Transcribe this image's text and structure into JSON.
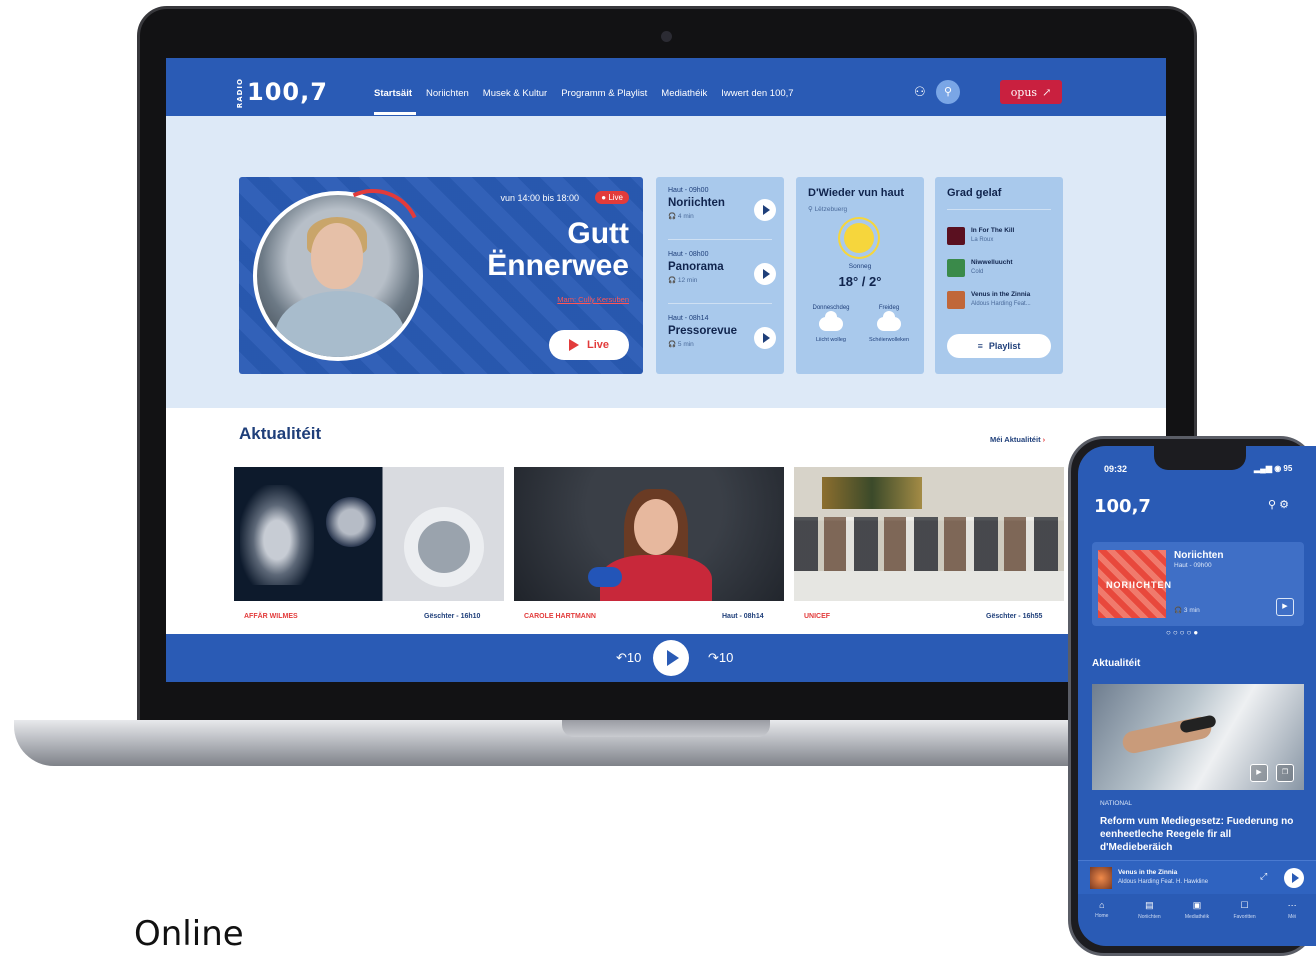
{
  "nav": {
    "logo": "100,7",
    "logo_small": "RADIO",
    "links": [
      "Startsäit",
      "Noriichten",
      "Musek & Kultur",
      "Programm & Playlist",
      "Mediathéik",
      "Iwwert den 100,7"
    ],
    "opus_label": "opus"
  },
  "hero": {
    "time": "vun 14:00 bis 18:00",
    "badge": "● Live",
    "title_line1": "Gutt",
    "title_line2": "Ënnerwee",
    "host": "Mam: Cully Kersuben",
    "live_button": "Live"
  },
  "news_items": [
    {
      "meta": "Haut - 09h00",
      "title": "Noriichten",
      "duration": "🎧 4 min"
    },
    {
      "meta": "Haut - 08h00",
      "title": "Panorama",
      "duration": "🎧 12 min"
    },
    {
      "meta": "Haut - 08h14",
      "title": "Pressorevue",
      "duration": "🎧 5 min"
    }
  ],
  "weather": {
    "title": "D'Wieder vun haut",
    "location": "⚲ Lëtzebuerg",
    "today": "Sonneg",
    "temp": "18° / 2°",
    "forecast": [
      {
        "day": "Donneschdeg",
        "desc": "Liicht wolleg"
      },
      {
        "day": "Freideg",
        "desc": "Schéierwolleken"
      }
    ]
  },
  "played": {
    "title": "Grad gelaf",
    "tracks": [
      {
        "name": "In For The Kill",
        "artist": "La Roux"
      },
      {
        "name": "Niwwelluucht",
        "artist": "Cold"
      },
      {
        "name": "Venus in the Zinnia",
        "artist": "Aldous Harding Feat..."
      }
    ],
    "playlist_button": "Playlist"
  },
  "aktualiteit": {
    "title": "Aktualitéit",
    "more": "Méi Aktualitéit",
    "articles": [
      {
        "category": "AFFÄR WILMES",
        "date": "Gëschter - 16h10"
      },
      {
        "category": "CAROLE HARTMANN",
        "date": "Haut - 08h14"
      },
      {
        "category": "UNICEF",
        "date": "Gëschter - 16h55"
      }
    ]
  },
  "player": {
    "back": "↶10",
    "forward": "↷10"
  },
  "phone": {
    "time": "09:32",
    "status": "▂▄▆ ◉ 95",
    "logo": "100,7",
    "card_title": "Noriichten",
    "card_sub": "Haut - 09h00",
    "card_dur": "🎧 3 min",
    "cover_text": "NORIICHTEN",
    "dots": "○○○○●",
    "aktualiteit": "Aktualitéit",
    "category": "NATIONAL",
    "headline": "Reform vum Mediegesetz: Fuederung no eenheetleche Reegele fir all d'Medieberäich",
    "mini_title": "Venus in the Zinnia",
    "mini_artist": "Aldous Harding Feat. H. Hawkline",
    "tabs": [
      "Home",
      "Noriichten",
      "Mediathéik",
      "Favoritten",
      "Méi"
    ]
  },
  "caption": "Online"
}
